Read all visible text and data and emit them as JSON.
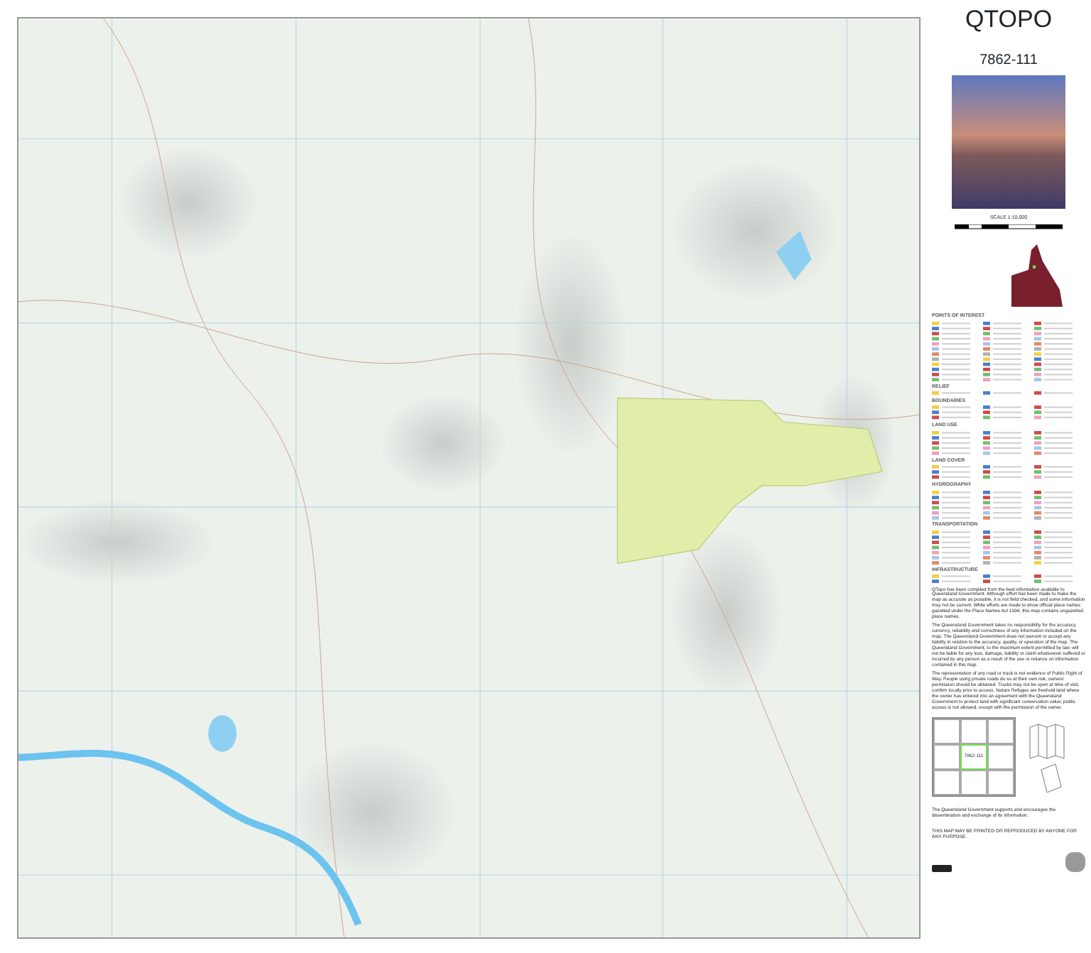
{
  "title": "QTOPO",
  "map_number": "7862-111",
  "scale": "SCALE 1:10,000",
  "legend": [
    {
      "heading": "POINTS OF INTEREST"
    },
    {
      "heading": "RELIEF"
    },
    {
      "heading": "BOUNDARIES"
    },
    {
      "heading": "LAND USE"
    },
    {
      "heading": "LAND COVER"
    },
    {
      "heading": "HYDROGRAPHY"
    },
    {
      "heading": "TRANSPORTATION"
    },
    {
      "heading": "INFRASTRUCTURE"
    }
  ],
  "notes": [
    "QTopo has been compiled from the best information available to Queensland Government. Although effort has been made to make the map as accurate as possible, it is not field checked, and some information may not be current. While efforts are made to show official place names gazetted under the Place Names Act 1994, this map contains ungazetted place names.",
    "The Queensland Government takes no responsibility for the accuracy, currency, reliability and correctness of any information included on the map. The Queensland Government does not warrant or accept any liability in relation to the accuracy, quality, or operation of the map. The Queensland Government, to the maximum extent permitted by law, will not be liable for any loss, damage, liability or claim whatsoever suffered or incurred by any person as a result of the use or reliance on information contained in this map.",
    "The representation of any road or track is not evidence of Public Right of Way. People using private roads do so at their own risk; owners' permission should be obtained. Tracks may not be open at time of visit, confirm locally prior to access. Nature Refuges are freehold land where the owner has entered into an agreement with the Queensland Government to protect land with significant conservation value; public access is not allowed, except with the permission of the owner."
  ],
  "index": [
    {
      "selected": false
    },
    {
      "selected": false
    },
    {
      "selected": false
    },
    {
      "selected": false
    },
    {
      "label": "7862-111",
      "selected": true
    },
    {
      "selected": false
    },
    {
      "selected": false
    },
    {
      "selected": false
    },
    {
      "selected": false
    }
  ],
  "footer": [
    "The Queensland Government supports and encourages the dissemination and exchange of its information.",
    "THIS MAP MAY BE PRINTED OR REPRODUCED BY ANYONE FOR ANY PURPOSE."
  ]
}
